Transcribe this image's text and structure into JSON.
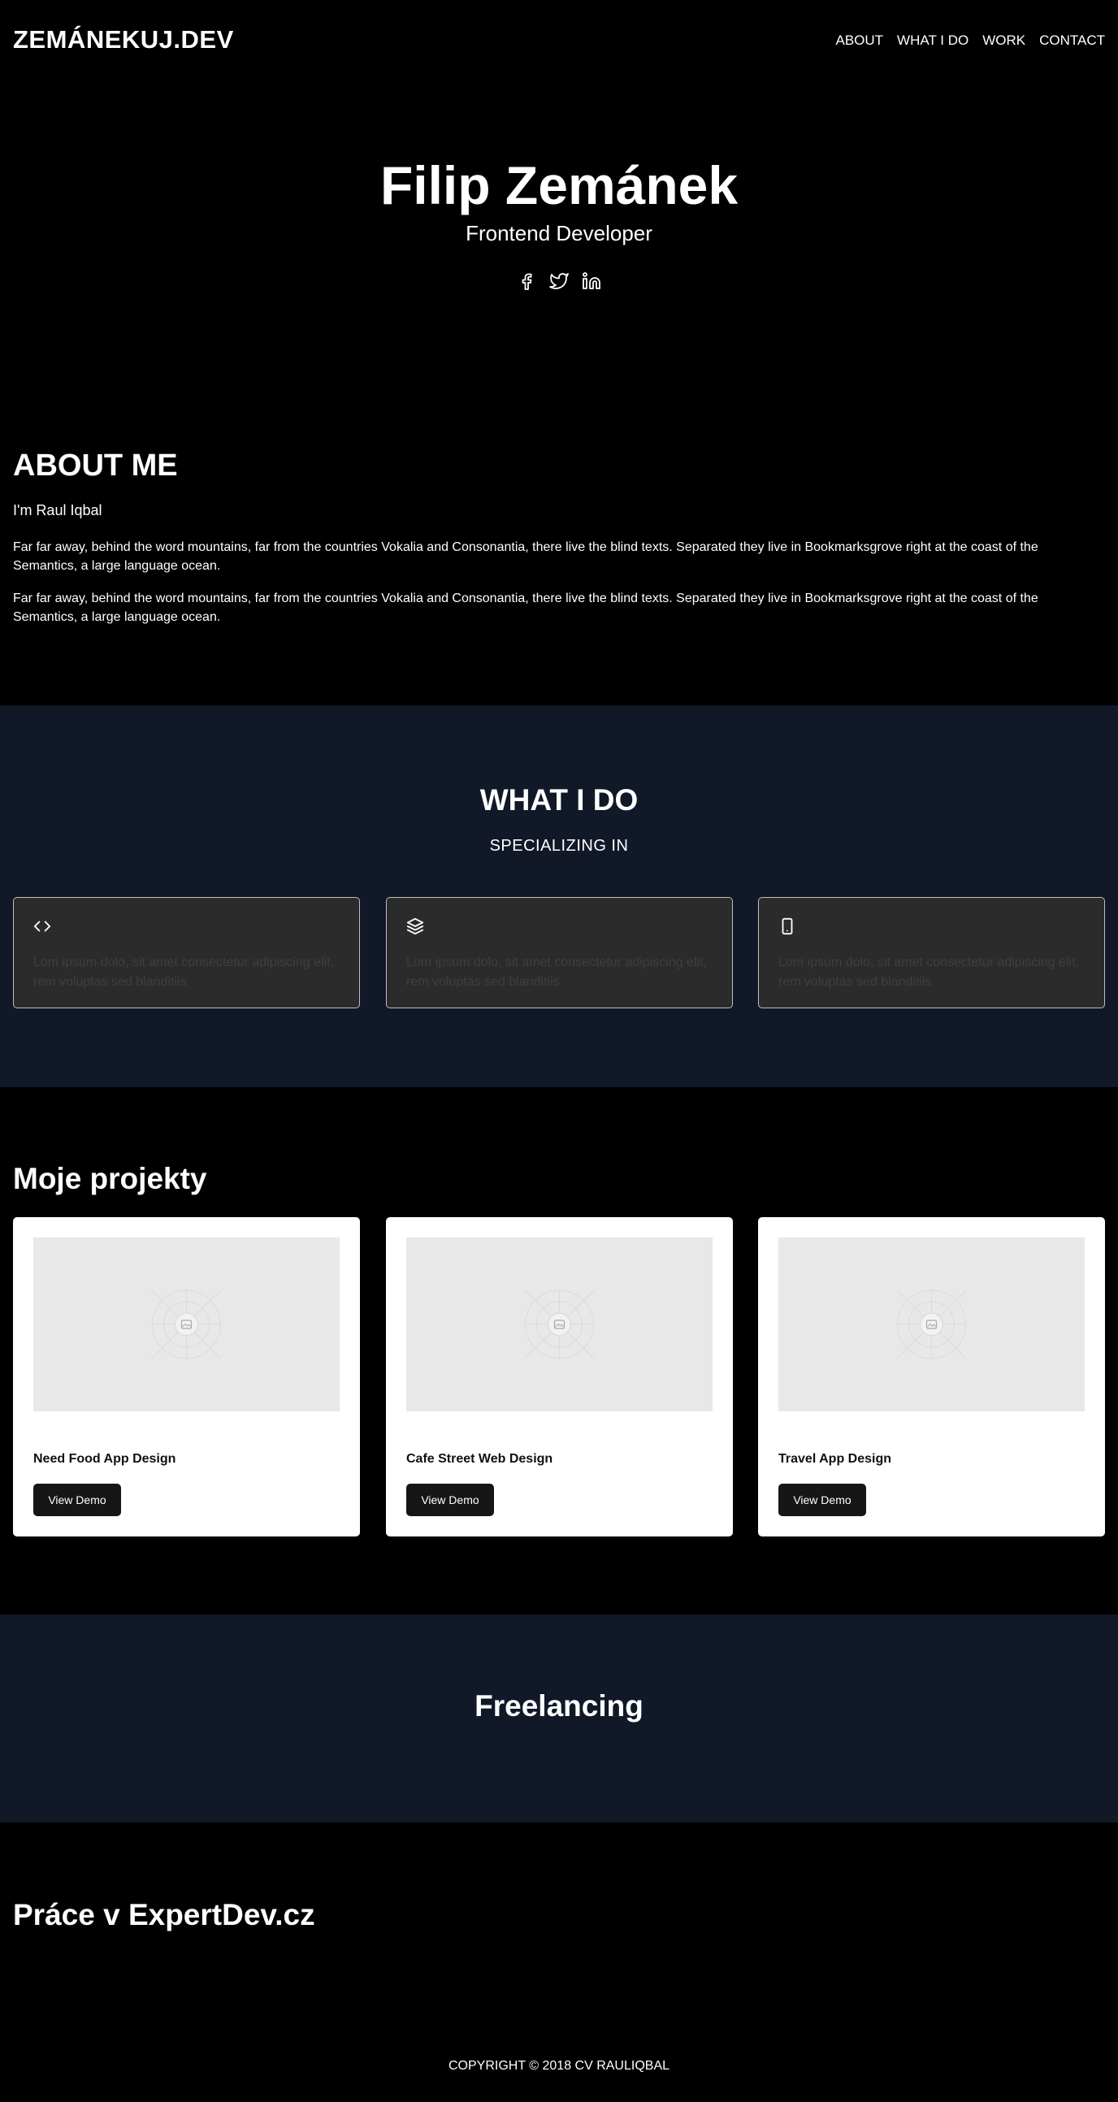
{
  "header": {
    "logo": "ZEMÁNEKUJ.DEV",
    "nav": [
      "ABOUT",
      "WHAT I DO",
      "WORK",
      "CONTACT"
    ]
  },
  "hero": {
    "name": "Filip Zemánek",
    "role": "Frontend Developer",
    "socials": [
      "facebook-icon",
      "twitter-icon",
      "linkedin-icon"
    ]
  },
  "about": {
    "title": "ABOUT ME",
    "greeting": "I'm Raul Iqbal",
    "paragraphs": [
      "Far far away, behind the word mountains, far from the countries Vokalia and Consonantia, there live the blind texts. Separated they live in Bookmarksgrove right at the coast of the Semantics, a large language ocean.",
      "Far far away, behind the word mountains, far from the countries Vokalia and Consonantia, there live the blind texts. Separated they live in Bookmarksgrove right at the coast of the Semantics, a large language ocean."
    ]
  },
  "whatido": {
    "title": "WHAT I DO",
    "subtitle": "SPECIALIZING IN",
    "services": [
      {
        "icon": "code-icon",
        "text": "Lom ipsum dolo, sit amet consectetur adipiscing elit, rem voluptas sed blanditiis"
      },
      {
        "icon": "layers-icon",
        "text": "Lom ipsum dolo, sit amet consectetur adipiscing elit, rem voluptas sed blanditiis"
      },
      {
        "icon": "mobile-icon",
        "text": "Lom ipsum dolo, sit amet consectetur adipiscing elit, rem voluptas sed blanditiis"
      }
    ]
  },
  "projects": {
    "title": "Moje projekty",
    "items": [
      {
        "name": "Need Food App Design",
        "button": "View Demo"
      },
      {
        "name": "Cafe Street Web Design",
        "button": "View Demo"
      },
      {
        "name": "Travel App Design",
        "button": "View Demo"
      }
    ]
  },
  "freelancing": {
    "title": "Freelancing"
  },
  "expertdev": {
    "title": "Práce v ExpertDev.cz"
  },
  "footer": {
    "copyright": "COPYRIGHT © 2018 CV RAULIQBAL"
  },
  "colors": {
    "page_bg": "#000000",
    "section_bg": "#111827",
    "card_bg": "#2b2b2b",
    "button_bg": "#161616"
  }
}
